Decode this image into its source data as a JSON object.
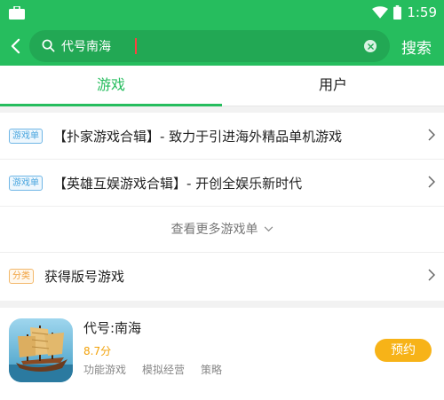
{
  "status_bar": {
    "time": "1:59",
    "icons": [
      "briefcase-icon",
      "wifi-icon",
      "battery-icon"
    ]
  },
  "header": {
    "search_value": "代号南海",
    "search_button": "搜索",
    "icons": [
      "back-arrow-icon",
      "search-icon",
      "clear-icon"
    ]
  },
  "tabs": [
    {
      "label": "游戏",
      "active": true
    },
    {
      "label": "用户",
      "active": false
    }
  ],
  "collections": [
    {
      "tag": "游戏单",
      "title": "【扑家游戏合辑】- 致力于引进海外精品单机游戏"
    },
    {
      "tag": "游戏单",
      "title": "【英雄互娱游戏合辑】- 开创全娱乐新时代"
    }
  ],
  "more_label": "查看更多游戏单",
  "category": {
    "tag": "分类",
    "title": "获得版号游戏"
  },
  "game": {
    "name": "代号:南海",
    "score": "8.7分",
    "categories": [
      "功能游戏",
      "模拟经营",
      "策略"
    ],
    "button": "预约"
  },
  "colors": {
    "brand_green": "#26bd5e",
    "tag_blue": "#4aa6df",
    "tag_orange": "#f0a13e",
    "score_orange": "#f2a20a",
    "button_yellow": "#f7b318"
  }
}
